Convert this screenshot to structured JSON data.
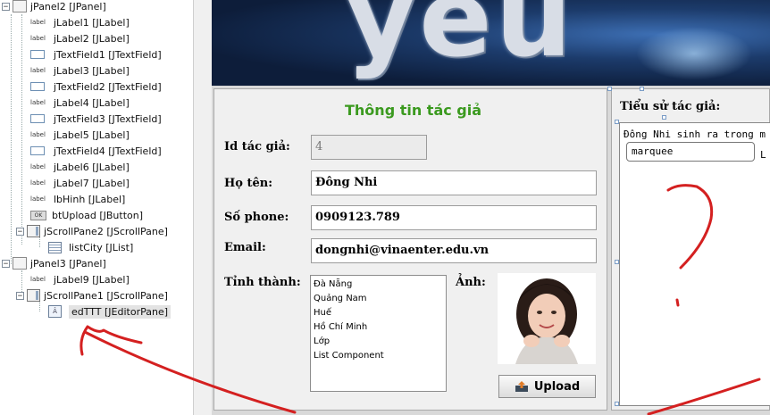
{
  "tree": {
    "items": [
      {
        "label": "jPanel2 [JPanel]",
        "icon": "panel-icon"
      },
      {
        "label": "jLabel1 [JLabel]",
        "icon": "label-icon"
      },
      {
        "label": "jLabel2 [JLabel]",
        "icon": "label-icon"
      },
      {
        "label": "jTextField1 [JTextField]",
        "icon": "textfield-icon"
      },
      {
        "label": "jLabel3 [JLabel]",
        "icon": "label-icon"
      },
      {
        "label": "jTextField2 [JTextField]",
        "icon": "textfield-icon"
      },
      {
        "label": "jLabel4 [JLabel]",
        "icon": "label-icon"
      },
      {
        "label": "jTextField3 [JTextField]",
        "icon": "textfield-icon"
      },
      {
        "label": "jLabel5 [JLabel]",
        "icon": "label-icon"
      },
      {
        "label": "jTextField4 [JTextField]",
        "icon": "textfield-icon"
      },
      {
        "label": "jLabel6 [JLabel]",
        "icon": "label-icon"
      },
      {
        "label": "jLabel7 [JLabel]",
        "icon": "label-icon"
      },
      {
        "label": "lbHinh [JLabel]",
        "icon": "label-icon"
      },
      {
        "label": "btUpload [JButton]",
        "icon": "button-icon"
      },
      {
        "label": "jScrollPane2 [JScrollPane]",
        "icon": "scrollpane-icon"
      },
      {
        "label": "listCity [JList]",
        "icon": "list-icon"
      },
      {
        "label": "jPanel3 [JPanel]",
        "icon": "panel-icon"
      },
      {
        "label": "jLabel9 [JLabel]",
        "icon": "label-icon"
      },
      {
        "label": "jScrollPane1 [JScrollPane]",
        "icon": "scrollpane-icon"
      },
      {
        "label": "edTTT [JEditorPane]",
        "icon": "editorpane-icon"
      }
    ],
    "label_icon_text": "label",
    "button_icon_text": "OK",
    "editor_icon_text": "Â"
  },
  "banner": {
    "text": "yeu thic"
  },
  "form": {
    "title": "Thông tin tác giả",
    "id_label": "Id tác giả:",
    "id_value": "4",
    "name_label": "Họ tên:",
    "name_value": "Đông Nhi",
    "phone_label": "Số phone:",
    "phone_value": "0909123.789",
    "email_label": "Email:",
    "email_value": "dongnhi@vinaenter.edu.vn",
    "city_label": "Tỉnh thành:",
    "cities": [
      "Đà Nẵng",
      "Quảng Nam",
      "Huế",
      "Hồ Chí Minh",
      "Lớp",
      "List Component"
    ],
    "photo_label": "Ảnh:",
    "upload_label": "Upload"
  },
  "bio": {
    "label": "Tiểu sử tác giả:",
    "text": "Đông Nhi sinh ra trong m",
    "marquee": "marquee",
    "marquee_suffix": "L"
  },
  "colors": {
    "title": "#3b9a1f",
    "annotation": "#d42020"
  }
}
